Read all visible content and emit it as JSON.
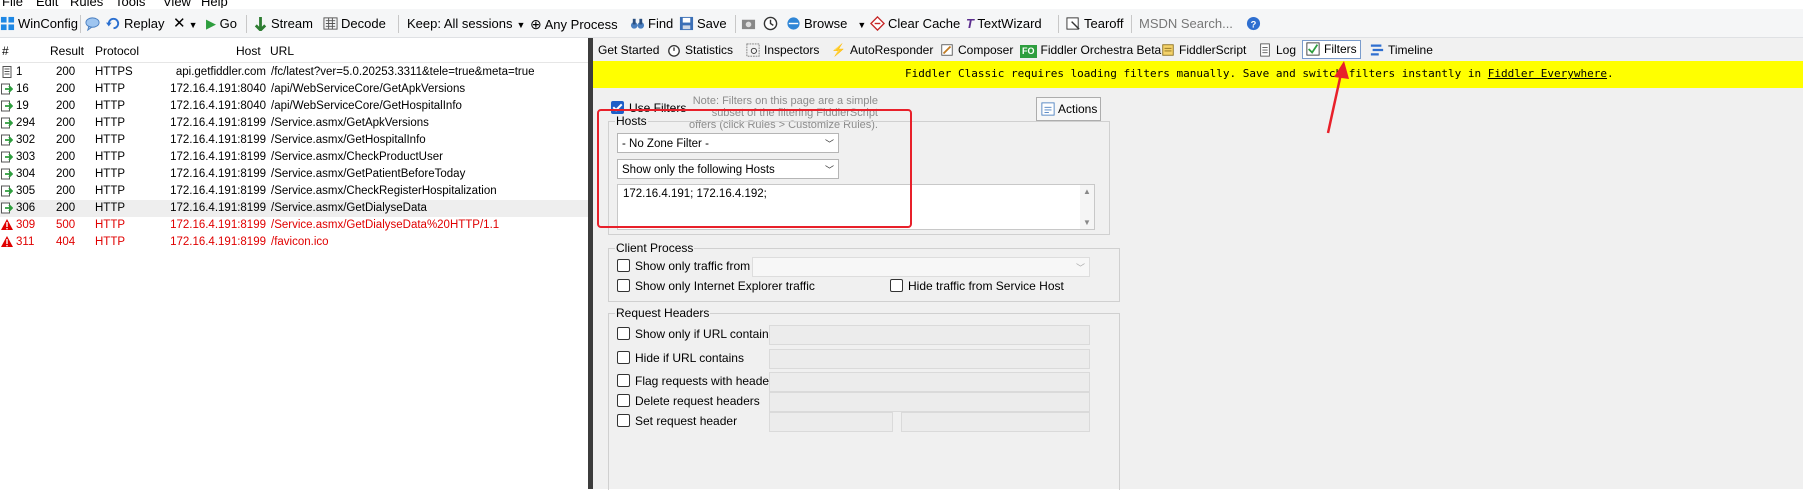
{
  "menu": [
    "File",
    "Edit",
    "Rules",
    "Tools",
    "View",
    "Help"
  ],
  "toolbar": {
    "winconfig": "WinConfig",
    "replay": "Replay",
    "remove": "✕",
    "go": "Go",
    "stream": "Stream",
    "decode": "Decode",
    "keep": "Keep: All sessions",
    "any_process": "Any Process",
    "find": "Find",
    "save": "Save",
    "browse": "Browse",
    "clear_cache": "Clear Cache",
    "textwizard": "TextWizard",
    "tearoff": "Tearoff",
    "msdn_placeholder": "MSDN Search..."
  },
  "sessions": {
    "columns": [
      "#",
      "Result",
      "Protocol",
      "Host",
      "URL"
    ],
    "rows": [
      {
        "id": "1",
        "result": "200",
        "protocol": "HTTPS",
        "host": "api.getfiddler.com",
        "url": "/fc/latest?ver=5.0.20253.3311&tele=true&meta=true"
      },
      {
        "id": "16",
        "result": "200",
        "protocol": "HTTP",
        "host": "172.16.4.191:8040",
        "url": "/api/WebServiceCore/GetApkVersions"
      },
      {
        "id": "19",
        "result": "200",
        "protocol": "HTTP",
        "host": "172.16.4.191:8040",
        "url": "/api/WebServiceCore/GetHospitalInfo"
      },
      {
        "id": "294",
        "result": "200",
        "protocol": "HTTP",
        "host": "172.16.4.191:8199",
        "url": "/Service.asmx/GetApkVersions"
      },
      {
        "id": "302",
        "result": "200",
        "protocol": "HTTP",
        "host": "172.16.4.191:8199",
        "url": "/Service.asmx/GetHospitalInfo"
      },
      {
        "id": "303",
        "result": "200",
        "protocol": "HTTP",
        "host": "172.16.4.191:8199",
        "url": "/Service.asmx/CheckProductUser"
      },
      {
        "id": "304",
        "result": "200",
        "protocol": "HTTP",
        "host": "172.16.4.191:8199",
        "url": "/Service.asmx/GetPatientBeforeToday"
      },
      {
        "id": "305",
        "result": "200",
        "protocol": "HTTP",
        "host": "172.16.4.191:8199",
        "url": "/Service.asmx/CheckRegisterHospitalization"
      },
      {
        "id": "306",
        "result": "200",
        "protocol": "HTTP",
        "host": "172.16.4.191:8199",
        "url": "/Service.asmx/GetDialyseData"
      },
      {
        "id": "309",
        "result": "500",
        "protocol": "HTTP",
        "host": "172.16.4.191:8199",
        "url": "/Service.asmx/GetDialyseData%20HTTP/1.1"
      },
      {
        "id": "311",
        "result": "404",
        "protocol": "HTTP",
        "host": "172.16.4.191:8199",
        "url": "/favicon.ico"
      }
    ]
  },
  "tabs": [
    "Get Started",
    "Statistics",
    "Inspectors",
    "AutoResponder",
    "Composer",
    "Fiddler Orchestra Beta",
    "FiddlerScript",
    "Log",
    "Filters",
    "Timeline"
  ],
  "banner": {
    "text": "Fiddler Classic requires loading filters manually. Save and switch filters instantly in ",
    "link": "Fiddler Everywhere",
    "tail": "."
  },
  "filters": {
    "use_filters": "Use Filters",
    "note": "Note: Filters on this page are a simple subset of the filtering FiddlerScript offers (click Rules > Customize Rules).",
    "actions": "Actions",
    "hosts": {
      "title": "Hosts",
      "zone": "- No Zone Filter -",
      "mode": "Show only the following Hosts",
      "list": "172.16.4.191; 172.16.4.192;"
    },
    "client_process": {
      "title": "Client Process",
      "show_only_from": "Show only traffic from",
      "show_only_ie": "Show only Internet Explorer traffic",
      "hide_service_host": "Hide traffic from Service Host"
    },
    "request_headers": {
      "title": "Request Headers",
      "url_contains": "Show only if URL contains",
      "hide_url": "Hide if URL contains",
      "flag_headers": "Flag requests with headers",
      "delete_headers": "Delete request headers",
      "set_header": "Set request header"
    }
  },
  "colors": {
    "highlight": "#e8202a",
    "banner": "#ffff00",
    "error": "#e00000"
  }
}
